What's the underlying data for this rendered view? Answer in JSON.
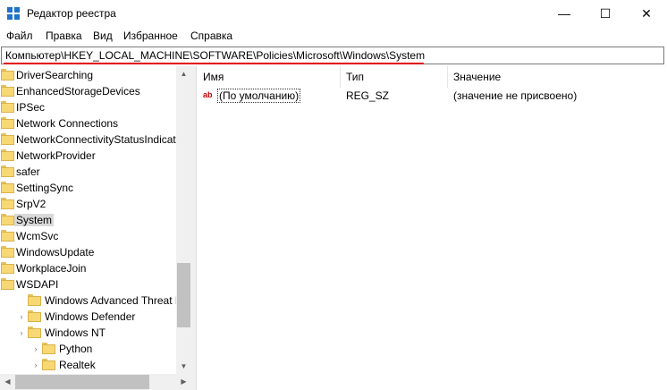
{
  "window": {
    "title": "Редактор реестра",
    "controls": {
      "minimize": "—",
      "maximize": "☐",
      "close": "✕"
    }
  },
  "menu": [
    "Файл",
    "Правка",
    "Вид",
    "Избранное",
    "Справка"
  ],
  "address": {
    "path": "Компьютер\\HKEY_LOCAL_MACHINE\\SOFTWARE\\Policies\\Microsoft\\Windows\\System",
    "underline_color": "#e00000"
  },
  "tree": {
    "items": [
      {
        "label": "DriverSearching",
        "level": 2,
        "expandable": false,
        "selected": false
      },
      {
        "label": "EnhancedStorageDevices",
        "level": 2,
        "expandable": false,
        "selected": false
      },
      {
        "label": "IPSec",
        "level": 2,
        "expandable": true,
        "selected": false
      },
      {
        "label": "Network Connections",
        "level": 2,
        "expandable": false,
        "selected": false
      },
      {
        "label": "NetworkConnectivityStatusIndicator",
        "level": 2,
        "expandable": true,
        "selected": false
      },
      {
        "label": "NetworkProvider",
        "level": 2,
        "expandable": true,
        "selected": false
      },
      {
        "label": "safer",
        "level": 2,
        "expandable": true,
        "selected": false
      },
      {
        "label": "SettingSync",
        "level": 2,
        "expandable": false,
        "selected": false
      },
      {
        "label": "SrpV2",
        "level": 2,
        "expandable": true,
        "selected": false
      },
      {
        "label": "System",
        "level": 2,
        "expandable": false,
        "selected": true
      },
      {
        "label": "WcmSvc",
        "level": 2,
        "expandable": true,
        "selected": false
      },
      {
        "label": "WindowsUpdate",
        "level": 2,
        "expandable": true,
        "selected": false
      },
      {
        "label": "WorkplaceJoin",
        "level": 2,
        "expandable": false,
        "selected": false
      },
      {
        "label": "WSDAPI",
        "level": 2,
        "expandable": true,
        "selected": false
      },
      {
        "label": "Windows Advanced Threat Protection",
        "level": 1,
        "expandable": false,
        "selected": false
      },
      {
        "label": "Windows Defender",
        "level": 1,
        "expandable": true,
        "selected": false
      },
      {
        "label": "Windows NT",
        "level": 1,
        "expandable": true,
        "selected": false
      },
      {
        "label": "Python",
        "level": 0,
        "expandable": true,
        "selected": false
      },
      {
        "label": "Realtek",
        "level": 0,
        "expandable": true,
        "selected": false
      }
    ]
  },
  "list": {
    "columns": [
      "Имя",
      "Тип",
      "Значение"
    ],
    "rows": [
      {
        "icon": "string-value-icon",
        "icon_text": "ab",
        "name": "(По умолчанию)",
        "type": "REG_SZ",
        "value": "(значение не присвоено)"
      }
    ]
  }
}
